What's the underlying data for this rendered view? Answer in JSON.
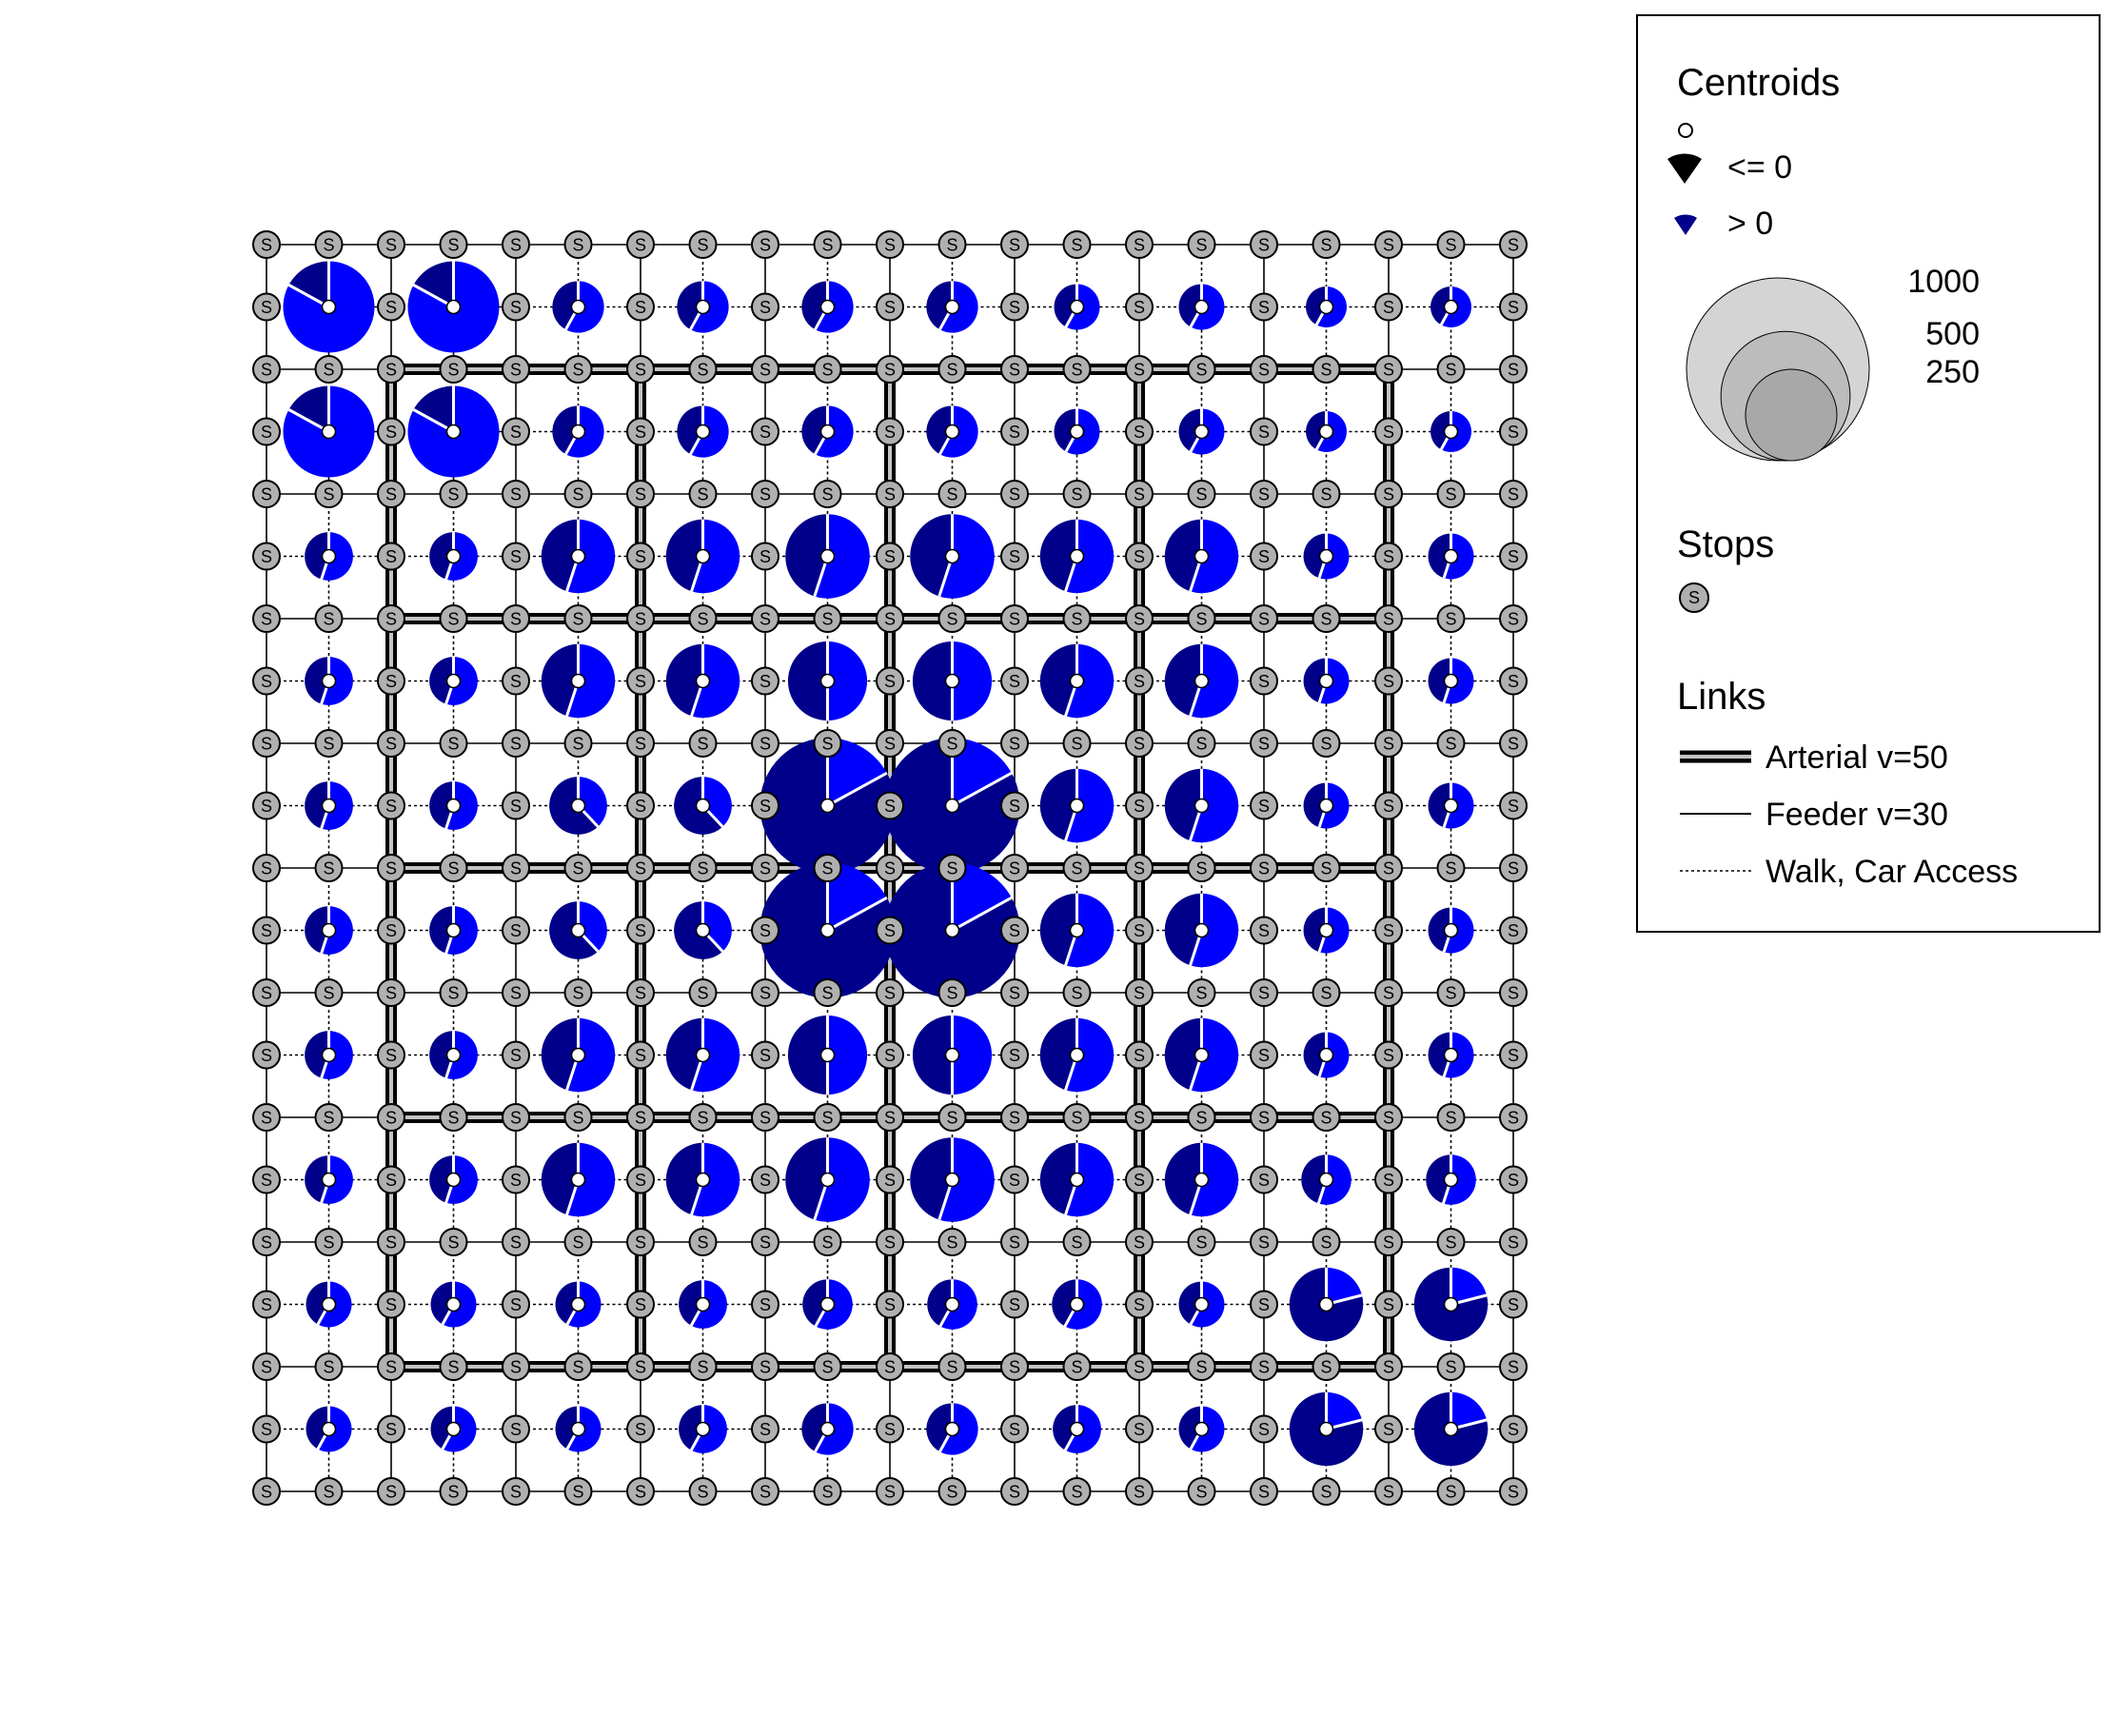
{
  "network": {
    "grid_columns": 21,
    "grid_rows": 21,
    "stop_label": "S",
    "arterial_rows": [
      2,
      6,
      10,
      14,
      18
    ],
    "arterial_columns": [
      2,
      6,
      10,
      14,
      18
    ],
    "arterial_extent": [
      2,
      18
    ]
  },
  "centroids": {
    "size_scale_max": 1000,
    "zones": [
      {
        "col": 1,
        "row": 1,
        "size": 1000,
        "share": 0.17
      },
      {
        "col": 3,
        "row": 1,
        "size": 1000,
        "share": 0.17
      },
      {
        "col": 5,
        "row": 1,
        "size": 320,
        "share": 0.42
      },
      {
        "col": 7,
        "row": 1,
        "size": 320,
        "share": 0.42
      },
      {
        "col": 9,
        "row": 1,
        "size": 320,
        "share": 0.42
      },
      {
        "col": 11,
        "row": 1,
        "size": 320,
        "share": 0.42
      },
      {
        "col": 13,
        "row": 1,
        "size": 250,
        "share": 0.42
      },
      {
        "col": 15,
        "row": 1,
        "size": 250,
        "share": 0.42
      },
      {
        "col": 17,
        "row": 1,
        "size": 200,
        "share": 0.42
      },
      {
        "col": 19,
        "row": 1,
        "size": 200,
        "share": 0.42
      },
      {
        "col": 1,
        "row": 3,
        "size": 1000,
        "share": 0.17
      },
      {
        "col": 3,
        "row": 3,
        "size": 1000,
        "share": 0.17
      },
      {
        "col": 5,
        "row": 3,
        "size": 320,
        "share": 0.42
      },
      {
        "col": 7,
        "row": 3,
        "size": 320,
        "share": 0.42
      },
      {
        "col": 9,
        "row": 3,
        "size": 320,
        "share": 0.42
      },
      {
        "col": 11,
        "row": 3,
        "size": 320,
        "share": 0.42
      },
      {
        "col": 13,
        "row": 3,
        "size": 250,
        "share": 0.42
      },
      {
        "col": 15,
        "row": 3,
        "size": 250,
        "share": 0.42
      },
      {
        "col": 17,
        "row": 3,
        "size": 200,
        "share": 0.42
      },
      {
        "col": 19,
        "row": 3,
        "size": 200,
        "share": 0.42
      },
      {
        "col": 1,
        "row": 5,
        "size": 280,
        "share": 0.45
      },
      {
        "col": 3,
        "row": 5,
        "size": 280,
        "share": 0.45
      },
      {
        "col": 5,
        "row": 5,
        "size": 650,
        "share": 0.45
      },
      {
        "col": 7,
        "row": 5,
        "size": 650,
        "share": 0.45
      },
      {
        "col": 9,
        "row": 5,
        "size": 850,
        "share": 0.45
      },
      {
        "col": 11,
        "row": 5,
        "size": 850,
        "share": 0.45
      },
      {
        "col": 13,
        "row": 5,
        "size": 650,
        "share": 0.45
      },
      {
        "col": 15,
        "row": 5,
        "size": 650,
        "share": 0.45
      },
      {
        "col": 17,
        "row": 5,
        "size": 250,
        "share": 0.45
      },
      {
        "col": 19,
        "row": 5,
        "size": 250,
        "share": 0.45
      },
      {
        "col": 1,
        "row": 7,
        "size": 280,
        "share": 0.45
      },
      {
        "col": 3,
        "row": 7,
        "size": 280,
        "share": 0.45
      },
      {
        "col": 5,
        "row": 7,
        "size": 650,
        "share": 0.45
      },
      {
        "col": 7,
        "row": 7,
        "size": 650,
        "share": 0.45
      },
      {
        "col": 9,
        "row": 7,
        "size": 750,
        "share": 0.5
      },
      {
        "col": 11,
        "row": 7,
        "size": 750,
        "share": 0.5
      },
      {
        "col": 13,
        "row": 7,
        "size": 650,
        "share": 0.45
      },
      {
        "col": 15,
        "row": 7,
        "size": 650,
        "share": 0.45
      },
      {
        "col": 17,
        "row": 7,
        "size": 250,
        "share": 0.45
      },
      {
        "col": 19,
        "row": 7,
        "size": 250,
        "share": 0.45
      },
      {
        "col": 1,
        "row": 9,
        "size": 280,
        "share": 0.45
      },
      {
        "col": 3,
        "row": 9,
        "size": 280,
        "share": 0.45
      },
      {
        "col": 5,
        "row": 9,
        "size": 400,
        "share": 0.62
      },
      {
        "col": 7,
        "row": 9,
        "size": 400,
        "share": 0.62
      },
      {
        "col": 9,
        "row": 9,
        "size": 2200,
        "share": 0.83
      },
      {
        "col": 11,
        "row": 9,
        "size": 2200,
        "share": 0.83
      },
      {
        "col": 13,
        "row": 9,
        "size": 650,
        "share": 0.45
      },
      {
        "col": 15,
        "row": 9,
        "size": 650,
        "share": 0.45
      },
      {
        "col": 17,
        "row": 9,
        "size": 250,
        "share": 0.45
      },
      {
        "col": 19,
        "row": 9,
        "size": 250,
        "share": 0.45
      },
      {
        "col": 1,
        "row": 11,
        "size": 280,
        "share": 0.45
      },
      {
        "col": 3,
        "row": 11,
        "size": 280,
        "share": 0.45
      },
      {
        "col": 5,
        "row": 11,
        "size": 400,
        "share": 0.62
      },
      {
        "col": 7,
        "row": 11,
        "size": 400,
        "share": 0.62
      },
      {
        "col": 9,
        "row": 11,
        "size": 2200,
        "share": 0.83
      },
      {
        "col": 11,
        "row": 11,
        "size": 2200,
        "share": 0.83
      },
      {
        "col": 13,
        "row": 11,
        "size": 650,
        "share": 0.45
      },
      {
        "col": 15,
        "row": 11,
        "size": 650,
        "share": 0.45
      },
      {
        "col": 17,
        "row": 11,
        "size": 250,
        "share": 0.45
      },
      {
        "col": 19,
        "row": 11,
        "size": 250,
        "share": 0.45
      },
      {
        "col": 1,
        "row": 13,
        "size": 280,
        "share": 0.45
      },
      {
        "col": 3,
        "row": 13,
        "size": 280,
        "share": 0.45
      },
      {
        "col": 5,
        "row": 13,
        "size": 650,
        "share": 0.45
      },
      {
        "col": 7,
        "row": 13,
        "size": 650,
        "share": 0.45
      },
      {
        "col": 9,
        "row": 13,
        "size": 750,
        "share": 0.5
      },
      {
        "col": 11,
        "row": 13,
        "size": 750,
        "share": 0.5
      },
      {
        "col": 13,
        "row": 13,
        "size": 650,
        "share": 0.45
      },
      {
        "col": 15,
        "row": 13,
        "size": 650,
        "share": 0.45
      },
      {
        "col": 17,
        "row": 13,
        "size": 250,
        "share": 0.45
      },
      {
        "col": 19,
        "row": 13,
        "size": 250,
        "share": 0.45
      },
      {
        "col": 1,
        "row": 15,
        "size": 280,
        "share": 0.45
      },
      {
        "col": 3,
        "row": 15,
        "size": 280,
        "share": 0.45
      },
      {
        "col": 5,
        "row": 15,
        "size": 650,
        "share": 0.45
      },
      {
        "col": 7,
        "row": 15,
        "size": 650,
        "share": 0.45
      },
      {
        "col": 9,
        "row": 15,
        "size": 850,
        "share": 0.45
      },
      {
        "col": 11,
        "row": 15,
        "size": 850,
        "share": 0.45
      },
      {
        "col": 13,
        "row": 15,
        "size": 650,
        "share": 0.45
      },
      {
        "col": 15,
        "row": 15,
        "size": 650,
        "share": 0.45
      },
      {
        "col": 17,
        "row": 15,
        "size": 300,
        "share": 0.45
      },
      {
        "col": 19,
        "row": 15,
        "size": 300,
        "share": 0.45
      },
      {
        "col": 1,
        "row": 17,
        "size": 250,
        "share": 0.42
      },
      {
        "col": 3,
        "row": 17,
        "size": 250,
        "share": 0.42
      },
      {
        "col": 5,
        "row": 17,
        "size": 250,
        "share": 0.42
      },
      {
        "col": 7,
        "row": 17,
        "size": 280,
        "share": 0.42
      },
      {
        "col": 9,
        "row": 17,
        "size": 300,
        "share": 0.42
      },
      {
        "col": 11,
        "row": 17,
        "size": 300,
        "share": 0.42
      },
      {
        "col": 13,
        "row": 17,
        "size": 300,
        "share": 0.42
      },
      {
        "col": 15,
        "row": 17,
        "size": 250,
        "share": 0.42
      },
      {
        "col": 17,
        "row": 17,
        "size": 650,
        "share": 0.79
      },
      {
        "col": 19,
        "row": 17,
        "size": 650,
        "share": 0.79
      },
      {
        "col": 1,
        "row": 19,
        "size": 250,
        "share": 0.42
      },
      {
        "col": 3,
        "row": 19,
        "size": 250,
        "share": 0.42
      },
      {
        "col": 5,
        "row": 19,
        "size": 250,
        "share": 0.42
      },
      {
        "col": 7,
        "row": 19,
        "size": 280,
        "share": 0.42
      },
      {
        "col": 9,
        "row": 19,
        "size": 320,
        "share": 0.42
      },
      {
        "col": 11,
        "row": 19,
        "size": 320,
        "share": 0.42
      },
      {
        "col": 13,
        "row": 19,
        "size": 280,
        "share": 0.42
      },
      {
        "col": 15,
        "row": 19,
        "size": 250,
        "share": 0.42
      },
      {
        "col": 17,
        "row": 19,
        "size": 650,
        "share": 0.79
      },
      {
        "col": 19,
        "row": 19,
        "size": 650,
        "share": 0.79
      }
    ]
  },
  "colors": {
    "pie_le_zero": "#00008b",
    "pie_gt_zero": "#0000ff",
    "stop_fill": "#b0b0b0",
    "size_circle_1000": "#d4d4d4",
    "size_circle_500": "#bcbcbc",
    "size_circle_250": "#a8a8a8"
  },
  "legend": {
    "centroids_title": "Centroids",
    "le_zero_label": "<= 0",
    "gt_zero_label": "> 0",
    "size_labels": [
      "1000",
      "500",
      "250"
    ],
    "size_values": [
      1000,
      500,
      250
    ],
    "stops_title": "Stops",
    "links_title": "Links",
    "arterial_label": "Arterial v=50",
    "feeder_label": "Feeder v=30",
    "walk_label": "Walk, Car Access"
  }
}
